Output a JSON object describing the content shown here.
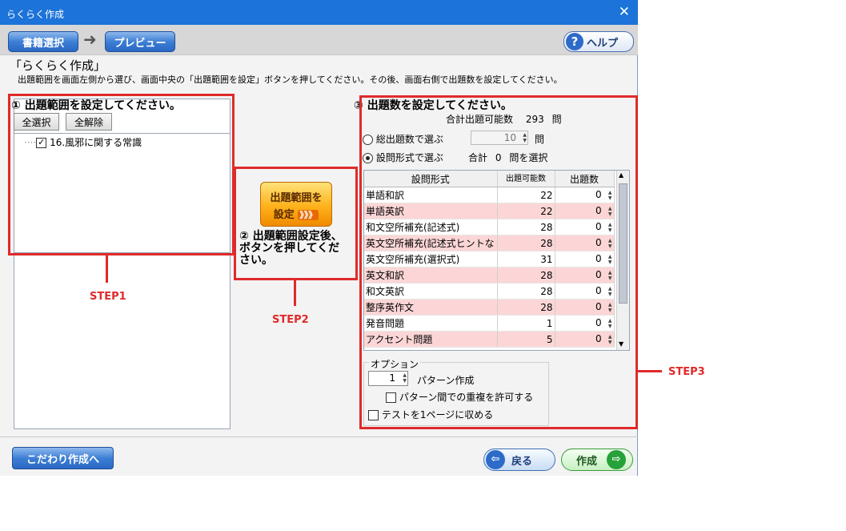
{
  "window": {
    "title": "らくらく作成",
    "close_icon": "close-icon"
  },
  "toolbar": {
    "book_select": "書籍選択",
    "preview": "プレビュー",
    "help": "ヘルプ"
  },
  "page": {
    "heading": "「らくらく作成」",
    "description": "出題範囲を画面左側から選び、画面中央の「出題範囲を設定」ボタンを押してください。その後、画面右側で出題数を設定してください。"
  },
  "step1": {
    "title": "①  出題範囲を設定してください。",
    "select_all": "全選択",
    "deselect_all": "全解除",
    "tree_item": "16.風邪に関する常識",
    "label": "STEP1"
  },
  "step2": {
    "button_line1": "出題範囲を",
    "button_line2": "設定",
    "chevrons": "》》》",
    "instruction": "②  出題範囲設定後、ボタンを押してください。",
    "label": "STEP2"
  },
  "step3": {
    "title": "③  出題数を設定してください。",
    "total_label": "合計出題可能数",
    "total_value": "293",
    "total_unit": "問",
    "radio_total": "総出題数で選ぶ",
    "total_count": "10",
    "total_count_unit": "問",
    "radio_format": "設問形式で選ぶ",
    "sum_label": "合計",
    "sum_value": "0",
    "sum_suffix": "問を選択",
    "label": "STEP3",
    "columns": [
      "設問形式",
      "出題可能数",
      "出題数"
    ],
    "rows": [
      {
        "name": "単語和訳",
        "available": "22",
        "count": "0"
      },
      {
        "name": "単語英訳",
        "available": "22",
        "count": "0"
      },
      {
        "name": "和文空所補充(記述式)",
        "available": "28",
        "count": "0"
      },
      {
        "name": "英文空所補充(記述式ヒントな",
        "available": "28",
        "count": "0"
      },
      {
        "name": "英文空所補充(選択式)",
        "available": "31",
        "count": "0"
      },
      {
        "name": "英文和訳",
        "available": "28",
        "count": "0"
      },
      {
        "name": "和文英訳",
        "available": "28",
        "count": "0"
      },
      {
        "name": "整序英作文",
        "available": "28",
        "count": "0"
      },
      {
        "name": "発音問題",
        "available": "1",
        "count": "0"
      },
      {
        "name": "アクセント問題",
        "available": "5",
        "count": "0"
      }
    ],
    "option_title": "オプション",
    "pattern_count": "1",
    "pattern_label": "パターン作成",
    "allow_dup": "パターン間での重複を許可する",
    "one_page": "テストを1ページに収める"
  },
  "footer": {
    "kodawari": "こだわり作成へ",
    "back": "戻る",
    "create": "作成"
  },
  "colors": {
    "accent_red": "#e02a2a",
    "title_blue": "#1c73d9",
    "row_pink": "#fcd6d6"
  }
}
